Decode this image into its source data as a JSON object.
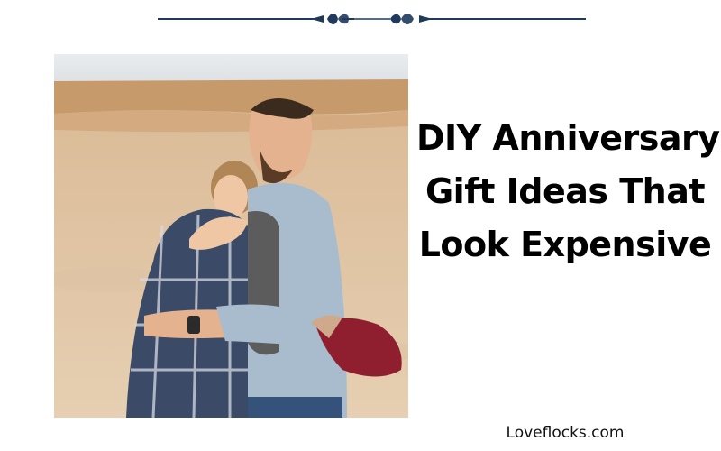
{
  "header": {
    "ornament_icon": "ornamental-divider-icon",
    "color": "#1f3a5c"
  },
  "photo": {
    "alt": "Couple hugging outdoors"
  },
  "headline": {
    "lines": [
      "DIY Anniversary",
      "Gift Ideas That",
      "Look Expensive"
    ]
  },
  "footer": {
    "site": "Loveflocks.com"
  }
}
